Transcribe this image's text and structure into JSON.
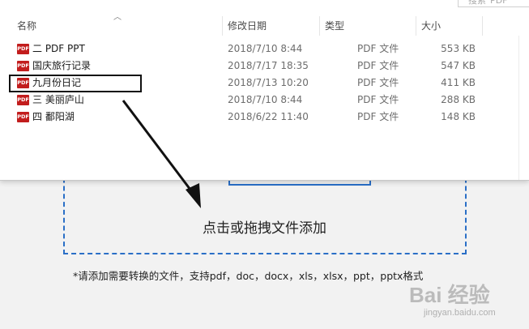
{
  "dialog": {
    "search_placeholder": "搜索\"PDF\"",
    "columns": {
      "name": "名称",
      "date": "修改日期",
      "type": "类型",
      "size": "大小"
    },
    "files": [
      {
        "name": "二 PDF PPT",
        "date": "2018/7/10 8:44",
        "type": "PDF 文件",
        "size": "553 KB"
      },
      {
        "name": "国庆旅行记录",
        "date": "2018/7/17 18:35",
        "type": "PDF 文件",
        "size": "547 KB"
      },
      {
        "name": "九月份日记",
        "date": "2018/7/13 10:20",
        "type": "PDF 文件",
        "size": "411 KB"
      },
      {
        "name": "三 美丽庐山",
        "date": "2018/7/10 8:44",
        "type": "PDF 文件",
        "size": "288 KB"
      },
      {
        "name": "四 鄱阳湖",
        "date": "2018/6/22 11:40",
        "type": "PDF 文件",
        "size": "148 KB"
      }
    ],
    "icon_label": "PDF"
  },
  "converter": {
    "drop_label": "点击或拖拽文件添加",
    "hint": "*请添加需要转换的文件，支持pdf，doc，docx，xls，xlsx，ppt，pptx格式"
  },
  "watermark": {
    "logo": "Bai 经验",
    "url": "jingyan.baidu.com"
  },
  "colors": {
    "accent": "#2a6fc7",
    "pdf_icon": "#c21d1d",
    "annotation": "#111111"
  }
}
